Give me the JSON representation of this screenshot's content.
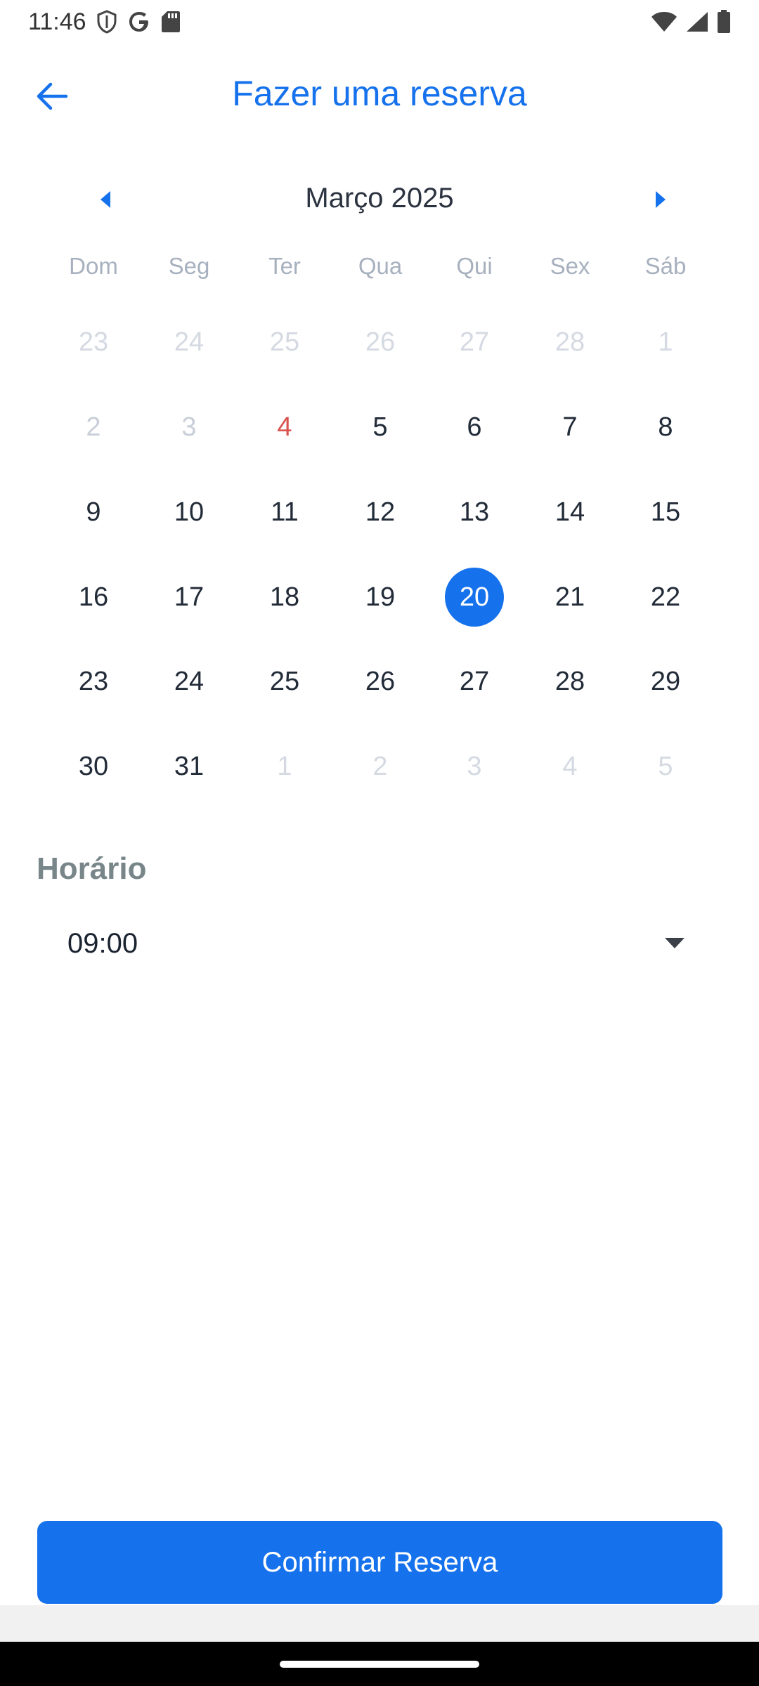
{
  "status_bar": {
    "time": "11:46",
    "icons_left": [
      "shield-icon",
      "google-icon",
      "sd-card-icon"
    ],
    "icons_right": [
      "wifi-icon",
      "signal-icon",
      "battery-icon"
    ]
  },
  "header": {
    "title": "Fazer uma reserva",
    "back_icon": "arrow-left-icon"
  },
  "colors": {
    "accent": "#1672ec",
    "today": "#d9534f",
    "label_gray": "#78868a"
  },
  "calendar": {
    "month_label": "Março 2025",
    "prev_icon": "caret-left-icon",
    "next_icon": "caret-right-icon",
    "weekdays": [
      "Dom",
      "Seg",
      "Ter",
      "Qua",
      "Qui",
      "Sex",
      "Sáb"
    ],
    "weeks": [
      [
        "23",
        "24",
        "25",
        "26",
        "27",
        "28",
        "1"
      ],
      [
        "2",
        "3",
        "4",
        "5",
        "6",
        "7",
        "8"
      ],
      [
        "9",
        "10",
        "11",
        "12",
        "13",
        "14",
        "15"
      ],
      [
        "16",
        "17",
        "18",
        "19",
        "20",
        "21",
        "22"
      ],
      [
        "23",
        "24",
        "25",
        "26",
        "27",
        "28",
        "29"
      ],
      [
        "30",
        "31",
        "1",
        "2",
        "3",
        "4",
        "5"
      ]
    ],
    "states": [
      [
        "muted",
        "muted",
        "muted",
        "muted",
        "muted",
        "muted",
        "muted"
      ],
      [
        "past",
        "past",
        "today",
        "",
        "",
        "",
        ""
      ],
      [
        "",
        "",
        "",
        "",
        "",
        "",
        ""
      ],
      [
        "",
        "",
        "",
        "",
        "selected",
        "",
        ""
      ],
      [
        "",
        "",
        "",
        "",
        "",
        "",
        ""
      ],
      [
        "",
        "",
        "muted",
        "muted",
        "muted",
        "muted",
        "muted"
      ]
    ],
    "selected_day": "20"
  },
  "time": {
    "label": "Horário",
    "value": "09:00",
    "dropdown_icon": "caret-down-icon"
  },
  "confirm_button": {
    "label": "Confirmar Reserva"
  }
}
